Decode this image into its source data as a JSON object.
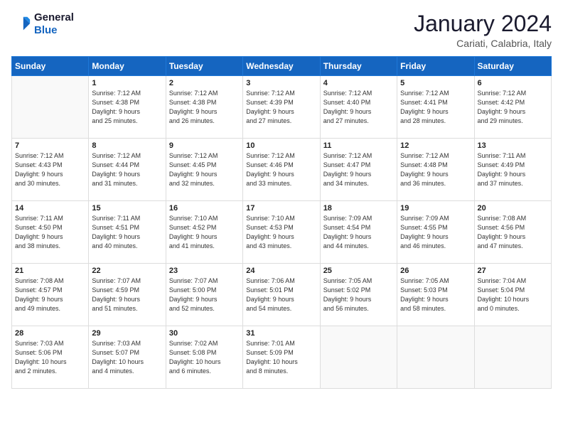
{
  "header": {
    "logo_general": "General",
    "logo_blue": "Blue",
    "month": "January 2024",
    "location": "Cariati, Calabria, Italy"
  },
  "days_of_week": [
    "Sunday",
    "Monday",
    "Tuesday",
    "Wednesday",
    "Thursday",
    "Friday",
    "Saturday"
  ],
  "weeks": [
    [
      {
        "day": "",
        "info": ""
      },
      {
        "day": "1",
        "info": "Sunrise: 7:12 AM\nSunset: 4:38 PM\nDaylight: 9 hours\nand 25 minutes."
      },
      {
        "day": "2",
        "info": "Sunrise: 7:12 AM\nSunset: 4:38 PM\nDaylight: 9 hours\nand 26 minutes."
      },
      {
        "day": "3",
        "info": "Sunrise: 7:12 AM\nSunset: 4:39 PM\nDaylight: 9 hours\nand 27 minutes."
      },
      {
        "day": "4",
        "info": "Sunrise: 7:12 AM\nSunset: 4:40 PM\nDaylight: 9 hours\nand 27 minutes."
      },
      {
        "day": "5",
        "info": "Sunrise: 7:12 AM\nSunset: 4:41 PM\nDaylight: 9 hours\nand 28 minutes."
      },
      {
        "day": "6",
        "info": "Sunrise: 7:12 AM\nSunset: 4:42 PM\nDaylight: 9 hours\nand 29 minutes."
      }
    ],
    [
      {
        "day": "7",
        "info": "Sunrise: 7:12 AM\nSunset: 4:43 PM\nDaylight: 9 hours\nand 30 minutes."
      },
      {
        "day": "8",
        "info": "Sunrise: 7:12 AM\nSunset: 4:44 PM\nDaylight: 9 hours\nand 31 minutes."
      },
      {
        "day": "9",
        "info": "Sunrise: 7:12 AM\nSunset: 4:45 PM\nDaylight: 9 hours\nand 32 minutes."
      },
      {
        "day": "10",
        "info": "Sunrise: 7:12 AM\nSunset: 4:46 PM\nDaylight: 9 hours\nand 33 minutes."
      },
      {
        "day": "11",
        "info": "Sunrise: 7:12 AM\nSunset: 4:47 PM\nDaylight: 9 hours\nand 34 minutes."
      },
      {
        "day": "12",
        "info": "Sunrise: 7:12 AM\nSunset: 4:48 PM\nDaylight: 9 hours\nand 36 minutes."
      },
      {
        "day": "13",
        "info": "Sunrise: 7:11 AM\nSunset: 4:49 PM\nDaylight: 9 hours\nand 37 minutes."
      }
    ],
    [
      {
        "day": "14",
        "info": "Sunrise: 7:11 AM\nSunset: 4:50 PM\nDaylight: 9 hours\nand 38 minutes."
      },
      {
        "day": "15",
        "info": "Sunrise: 7:11 AM\nSunset: 4:51 PM\nDaylight: 9 hours\nand 40 minutes."
      },
      {
        "day": "16",
        "info": "Sunrise: 7:10 AM\nSunset: 4:52 PM\nDaylight: 9 hours\nand 41 minutes."
      },
      {
        "day": "17",
        "info": "Sunrise: 7:10 AM\nSunset: 4:53 PM\nDaylight: 9 hours\nand 43 minutes."
      },
      {
        "day": "18",
        "info": "Sunrise: 7:09 AM\nSunset: 4:54 PM\nDaylight: 9 hours\nand 44 minutes."
      },
      {
        "day": "19",
        "info": "Sunrise: 7:09 AM\nSunset: 4:55 PM\nDaylight: 9 hours\nand 46 minutes."
      },
      {
        "day": "20",
        "info": "Sunrise: 7:08 AM\nSunset: 4:56 PM\nDaylight: 9 hours\nand 47 minutes."
      }
    ],
    [
      {
        "day": "21",
        "info": "Sunrise: 7:08 AM\nSunset: 4:57 PM\nDaylight: 9 hours\nand 49 minutes."
      },
      {
        "day": "22",
        "info": "Sunrise: 7:07 AM\nSunset: 4:59 PM\nDaylight: 9 hours\nand 51 minutes."
      },
      {
        "day": "23",
        "info": "Sunrise: 7:07 AM\nSunset: 5:00 PM\nDaylight: 9 hours\nand 52 minutes."
      },
      {
        "day": "24",
        "info": "Sunrise: 7:06 AM\nSunset: 5:01 PM\nDaylight: 9 hours\nand 54 minutes."
      },
      {
        "day": "25",
        "info": "Sunrise: 7:05 AM\nSunset: 5:02 PM\nDaylight: 9 hours\nand 56 minutes."
      },
      {
        "day": "26",
        "info": "Sunrise: 7:05 AM\nSunset: 5:03 PM\nDaylight: 9 hours\nand 58 minutes."
      },
      {
        "day": "27",
        "info": "Sunrise: 7:04 AM\nSunset: 5:04 PM\nDaylight: 10 hours\nand 0 minutes."
      }
    ],
    [
      {
        "day": "28",
        "info": "Sunrise: 7:03 AM\nSunset: 5:06 PM\nDaylight: 10 hours\nand 2 minutes."
      },
      {
        "day": "29",
        "info": "Sunrise: 7:03 AM\nSunset: 5:07 PM\nDaylight: 10 hours\nand 4 minutes."
      },
      {
        "day": "30",
        "info": "Sunrise: 7:02 AM\nSunset: 5:08 PM\nDaylight: 10 hours\nand 6 minutes."
      },
      {
        "day": "31",
        "info": "Sunrise: 7:01 AM\nSunset: 5:09 PM\nDaylight: 10 hours\nand 8 minutes."
      },
      {
        "day": "",
        "info": ""
      },
      {
        "day": "",
        "info": ""
      },
      {
        "day": "",
        "info": ""
      }
    ]
  ]
}
